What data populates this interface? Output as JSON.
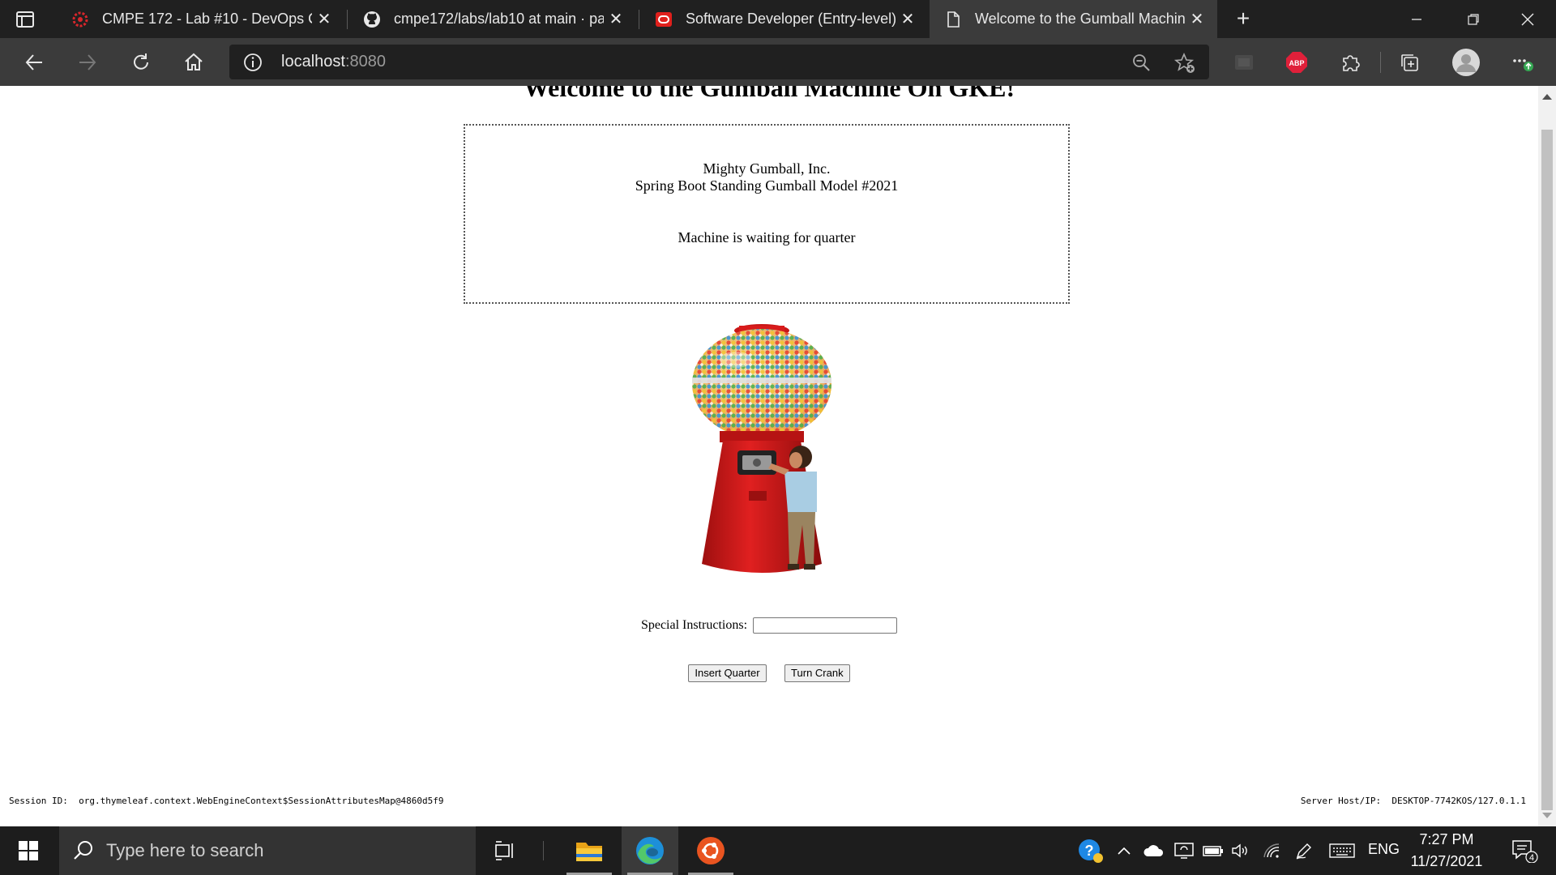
{
  "browser": {
    "tabs": [
      {
        "title": "CMPE 172 - Lab #10 - DevOps C",
        "icon": "cmpe-logo-icon",
        "active": false
      },
      {
        "title": "cmpe172/labs/lab10 at main · pa",
        "icon": "github-icon",
        "active": false
      },
      {
        "title": "Software Developer (Entry-level)",
        "icon": "oracle-icon",
        "active": false
      },
      {
        "title": "Welcome to the Gumball Machin",
        "icon": "page-icon",
        "active": true
      }
    ],
    "address": {
      "host": "localhost",
      "port": ":8080"
    },
    "abp_label": "ABP"
  },
  "page": {
    "heading": "Welcome to the Gumball Machine On GKE!",
    "company": "Mighty Gumball, Inc.",
    "model": "Spring Boot Standing Gumball Model #2021",
    "status": "Machine is waiting for quarter",
    "instructions_label": "Special Instructions:",
    "instructions_value": "",
    "insert_quarter_label": "Insert Quarter",
    "turn_crank_label": "Turn Crank",
    "session_label": "Session ID:",
    "session_value": "org.thymeleaf.context.WebEngineContext$SessionAttributesMap@4860d5f9",
    "server_label": "Server Host/IP:",
    "server_value": "DESKTOP-7742KOS/127.0.1.1"
  },
  "taskbar": {
    "search_placeholder": "Type here to search",
    "language": "ENG",
    "time": "7:27 PM",
    "date": "11/27/2021",
    "notification_count": "4"
  },
  "colors": {
    "tabstrip": "#202020",
    "toolbar": "#3b3b3b",
    "taskbar": "#1d1d1d",
    "abp_red": "#e0203a",
    "gumball_red": "#d81b1b"
  }
}
